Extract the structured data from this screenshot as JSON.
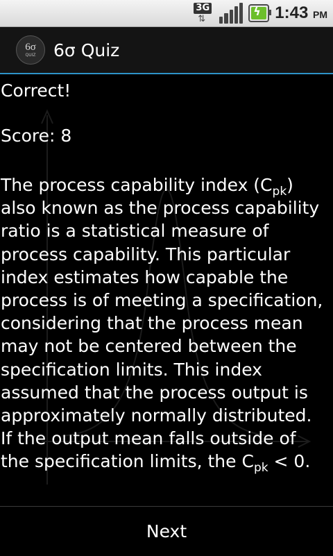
{
  "status_bar": {
    "network_label": "3G",
    "time": "1:43",
    "ampm": "PM",
    "icons": [
      "3g-data-icon",
      "signal-strength-icon",
      "battery-charging-icon"
    ]
  },
  "app": {
    "icon_text": "6σ",
    "icon_subtext": "QUIZ",
    "title": "6σ Quiz",
    "accent_color": "#2e93c8"
  },
  "quiz": {
    "result": "Correct!",
    "score_text": "Score: 8",
    "explanation_lines": [
      {
        "pre": "The process capability index (C",
        "sub": "pk",
        "post": ")"
      },
      {
        "pre": "also known as the process capability",
        "sub": "",
        "post": ""
      },
      {
        "pre": "ratio is a statistical measure of",
        "sub": "",
        "post": ""
      },
      {
        "pre": "process capability. This particular",
        "sub": "",
        "post": ""
      },
      {
        "pre": "index estimates how capable the",
        "sub": "",
        "post": ""
      },
      {
        "pre": "process is of meeting a specification,",
        "sub": "",
        "post": ""
      },
      {
        "pre": "considering that the process mean",
        "sub": "",
        "post": ""
      },
      {
        "pre": "may not be centered between the",
        "sub": "",
        "post": ""
      },
      {
        "pre": "specification limits. This index",
        "sub": "",
        "post": ""
      },
      {
        "pre": "assumed that the process output is",
        "sub": "",
        "post": ""
      },
      {
        "pre": "approximately normally distributed.",
        "sub": "",
        "post": ""
      },
      {
        "pre": "If the output mean falls outside of",
        "sub": "",
        "post": ""
      },
      {
        "pre": "the specification limits, the C",
        "sub": "pk",
        "post": " < 0."
      }
    ]
  },
  "footer": {
    "next_label": "Next"
  }
}
